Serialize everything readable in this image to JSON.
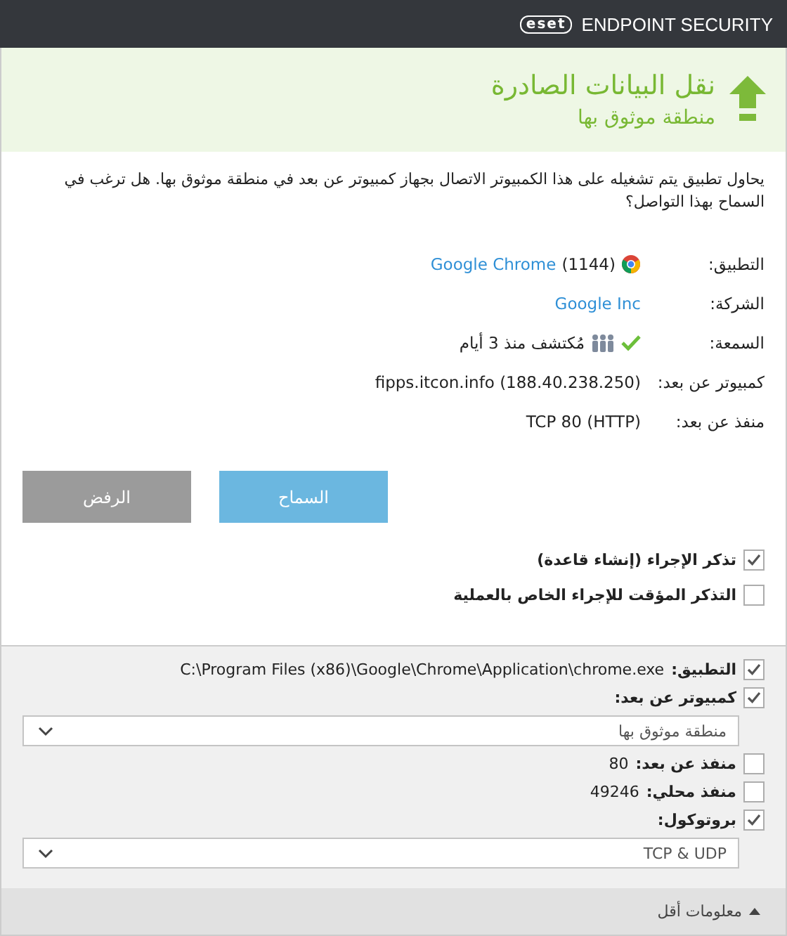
{
  "title_bar": {
    "logo": "eset",
    "product": "ENDPOINT SECURITY"
  },
  "header": {
    "title": "نقل البيانات الصادرة",
    "subtitle": "منطقة موثوق بها"
  },
  "message": "يحاول تطبيق يتم تشغيله على هذا الكمبيوتر الاتصال بجهاز كمبيوتر عن بعد في منطقة موثوق بها. هل ترغب في السماح بهذا التواصل؟",
  "details": [
    {
      "kind": "app",
      "label": "التطبيق:",
      "value": "Google Chrome",
      "extra": "(1144)"
    },
    {
      "kind": "link",
      "label": "الشركة:",
      "value": "Google Inc"
    },
    {
      "kind": "reputation",
      "label": "السمعة:",
      "value": "مُكتشف منذ 3 أيام"
    },
    {
      "kind": "plain",
      "label": "كمبيوتر عن بعد:",
      "value": "fipps.itcon.info (188.40.238.250)"
    },
    {
      "kind": "plain",
      "label": "منفذ عن بعد:",
      "value": "TCP 80 (HTTP)"
    }
  ],
  "buttons": [
    {
      "label": "السماح",
      "kind": "primary"
    },
    {
      "label": "الرفض",
      "kind": "secondary"
    }
  ],
  "options": [
    {
      "label": "تذكر الإجراء (إنشاء قاعدة)",
      "checked": true
    },
    {
      "label": "التذكر المؤقت للإجراء الخاص بالعملية",
      "checked": false
    }
  ],
  "rule": [
    {
      "kind": "check",
      "label": "التطبيق:",
      "value": "C:\\Program Files (x86)\\Google\\Chrome\\Application\\chrome.exe",
      "checked": true
    },
    {
      "kind": "check",
      "label": "كمبيوتر عن بعد:",
      "checked": true
    },
    {
      "kind": "select",
      "value": "منطقة موثوق بها"
    },
    {
      "kind": "check",
      "label": "منفذ عن بعد:",
      "value": "80",
      "checked": false
    },
    {
      "kind": "check",
      "label": "منفذ محلي:",
      "value": "49246",
      "checked": false
    },
    {
      "kind": "check",
      "label": "بروتوكول:",
      "checked": true
    },
    {
      "kind": "select",
      "value": "TCP & UDP"
    }
  ],
  "footer": {
    "label": "معلومات أقل"
  }
}
